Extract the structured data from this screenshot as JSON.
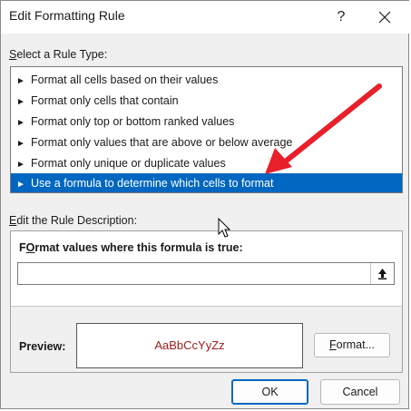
{
  "dialog": {
    "title": "Edit Formatting Rule",
    "help_label": "?",
    "close_label": "✕"
  },
  "rule_type": {
    "label_key": "S",
    "label_rest": "elect a Rule Type:",
    "items": [
      {
        "label": "Format all cells based on their values"
      },
      {
        "label": "Format only cells that contain"
      },
      {
        "label": "Format only top or bottom ranked values"
      },
      {
        "label": "Format only values that are above or below average"
      },
      {
        "label": "Format only unique or duplicate values"
      },
      {
        "label": "Use a formula to determine which cells to format"
      }
    ],
    "selected_index": 5,
    "bullet_icon": "triangle-right-icon"
  },
  "description": {
    "label_key": "E",
    "label_rest": "dit the Rule Description:",
    "formula_label_key": "O",
    "formula_label_pre": "F",
    "formula_label_rest": "rmat values where this formula is true:",
    "formula_value": "",
    "collapse_icon": "collapse-dialog-icon",
    "preview_label": "Preview:",
    "preview_sample": "AaBbCcYyZz",
    "preview_color": "#9c1c1c",
    "format_button_key": "F",
    "format_button_rest": "ormat..."
  },
  "footer": {
    "ok_label": "OK",
    "cancel_label": "Cancel"
  },
  "colors": {
    "selection": "#0067c0",
    "annotation_arrow": "#e8202a"
  }
}
